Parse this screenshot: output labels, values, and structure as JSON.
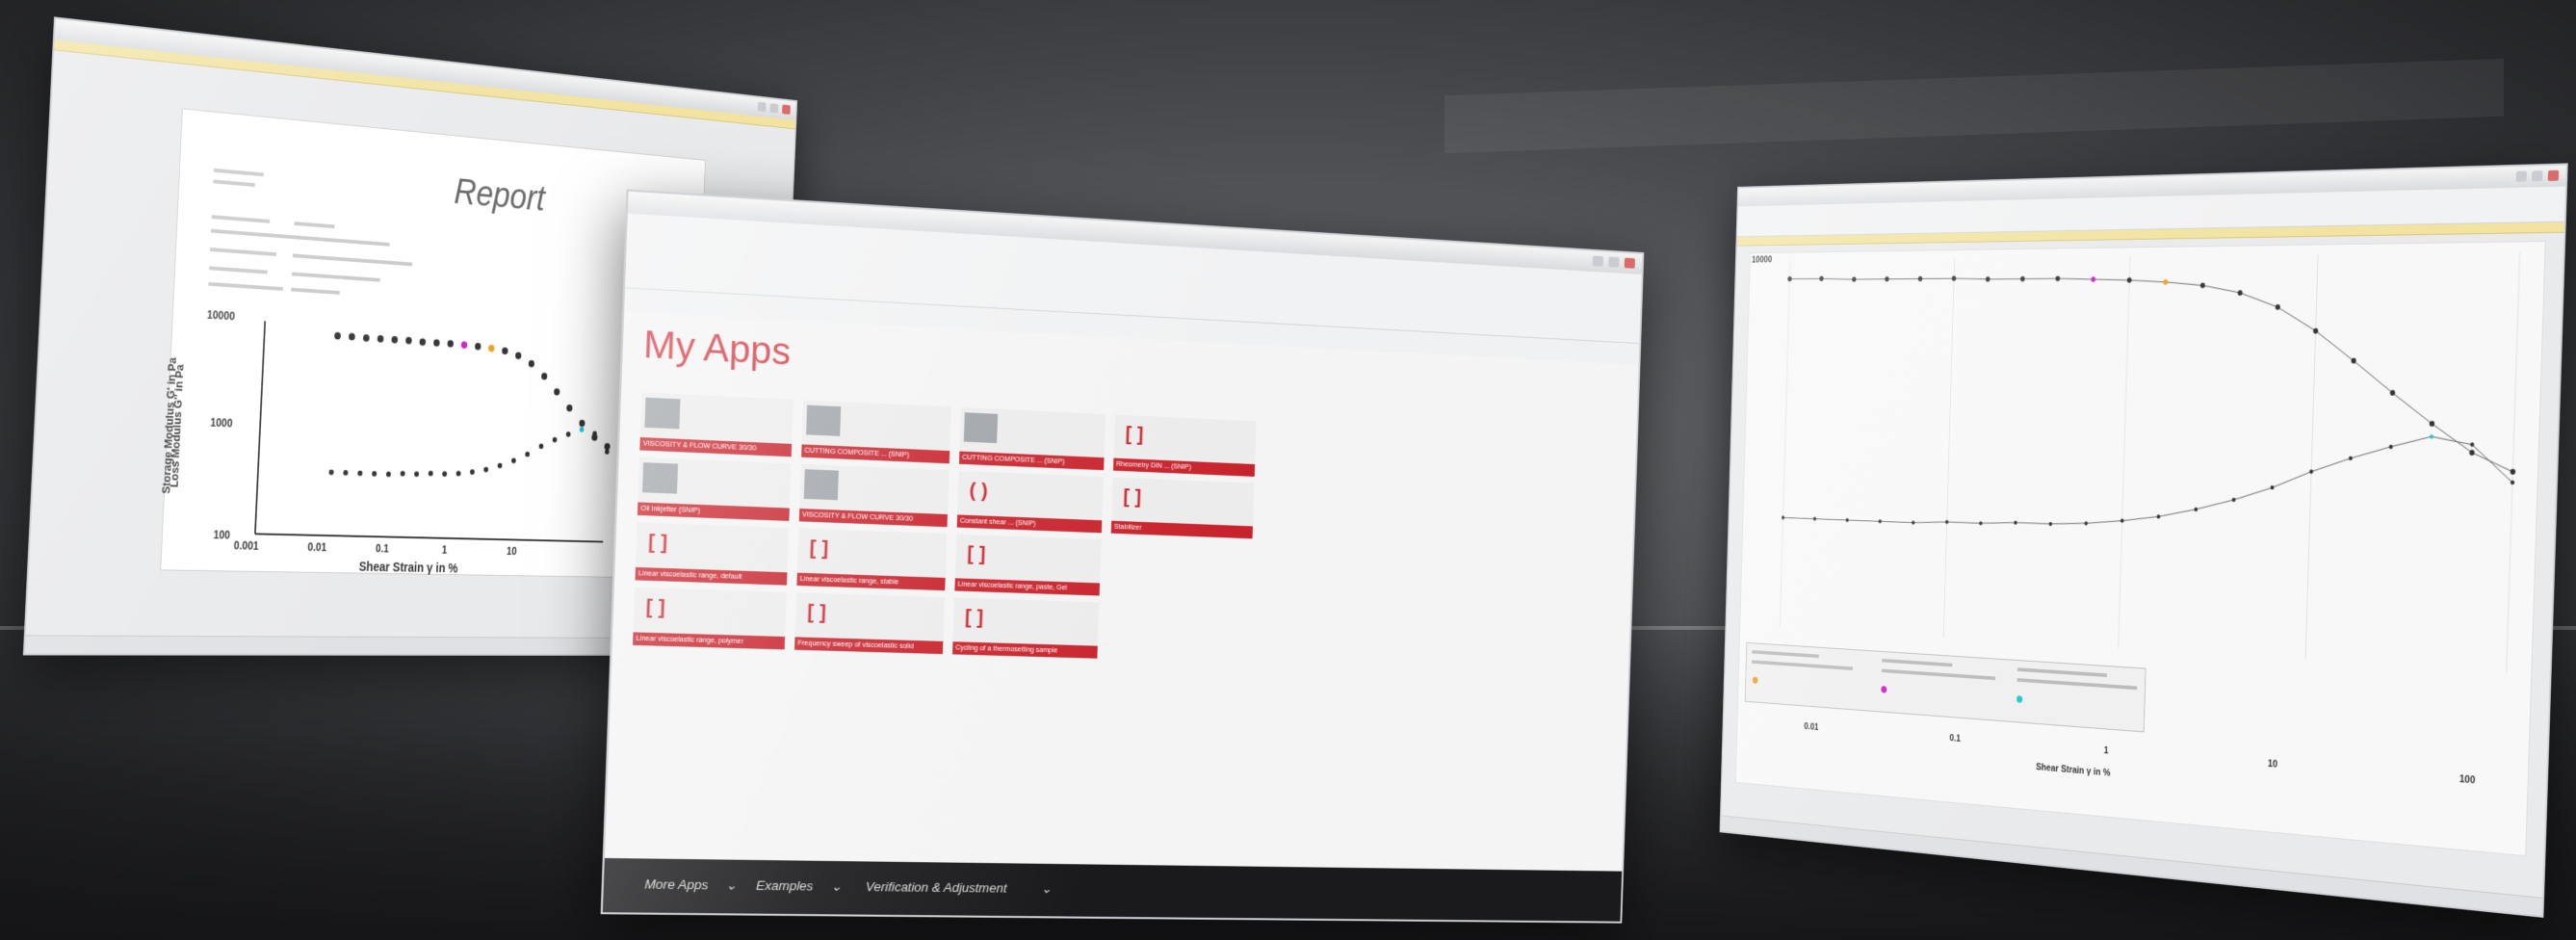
{
  "report_window": {
    "title": "Report",
    "y_axis_label_1": "Storage Modulus G' in Pa",
    "y_axis_label_2": "Loss Modulus G'' in Pa",
    "x_axis_label": "Shear Strain γ in %",
    "y_ticks": [
      "10000",
      "1000",
      "100"
    ],
    "x_ticks": [
      "0.001",
      "0.01",
      "0.1",
      "1",
      "10"
    ]
  },
  "apps_window": {
    "heading": "My Apps",
    "tiles": [
      "VISCOSITY & FLOW CURVE 30/30",
      "CUTTING COMPOSITE ... (SNIP)",
      "CUTTING COMPOSITE ... (SNIP)",
      "Rheometry DIN ... (SNIP)",
      "Oil Inkjetter (SNIP)",
      "VISCOSITY & FLOW CURVE 30/30",
      "Constant shear ... (SNIP)",
      "Stabilizer",
      "Linear viscoelastic range, default",
      "Linear viscoelastic range, stable",
      "Linear viscoelastic range, paste, Gel",
      "Linear viscoelastic range, polymer",
      "Frequency sweep of viscoelastic solid",
      "Cycling of a thermosetting sample"
    ],
    "bottom_nav": {
      "more_apps": "More Apps",
      "examples": "Examples",
      "verification": "Verification & Adjustment"
    }
  },
  "curve_window": {
    "x_axis_label": "Shear Strain γ in %",
    "x_ticks": [
      "0.01",
      "0.1",
      "1",
      "10",
      "100"
    ],
    "y_top_tick": "10000"
  },
  "colors": {
    "accent_red": "#c8232c",
    "heading_red": "#d0363f",
    "marker_magenta": "#d020c8",
    "marker_orange": "#f0a020",
    "marker_cyan": "#20c8d0"
  },
  "chart_data": [
    {
      "type": "scatter",
      "title": "",
      "xlabel": "Shear Strain γ in %",
      "ylabel": "Storage Modulus G' in Pa / Loss Modulus G'' in Pa",
      "x_scale": "log",
      "y_scale": "log",
      "xlim": [
        0.001,
        100
      ],
      "ylim": [
        100,
        10000
      ],
      "series": [
        {
          "name": "Storage Modulus G'",
          "x": [
            0.01,
            0.0158,
            0.0251,
            0.0398,
            0.0631,
            0.1,
            0.158,
            0.251,
            0.398,
            0.631,
            1,
            1.58,
            2.51,
            3.98,
            6.31,
            10,
            15.8,
            25.1,
            39.8,
            63.1,
            100
          ],
          "y": [
            8000,
            8000,
            7900,
            7900,
            7900,
            7900,
            7800,
            7800,
            7800,
            7700,
            7600,
            7400,
            7100,
            6500,
            5500,
            4200,
            3000,
            2100,
            1500,
            1100,
            900
          ]
        },
        {
          "name": "Loss Modulus G''",
          "x": [
            0.01,
            0.0158,
            0.0251,
            0.0398,
            0.0631,
            0.1,
            0.158,
            0.251,
            0.398,
            0.631,
            1,
            1.58,
            2.51,
            3.98,
            6.31,
            10,
            15.8,
            25.1,
            39.8,
            63.1,
            100
          ],
          "y": [
            400,
            400,
            400,
            400,
            400,
            410,
            410,
            420,
            420,
            430,
            450,
            480,
            530,
            600,
            700,
            850,
            1000,
            1150,
            1300,
            1200,
            800
          ]
        }
      ]
    }
  ]
}
